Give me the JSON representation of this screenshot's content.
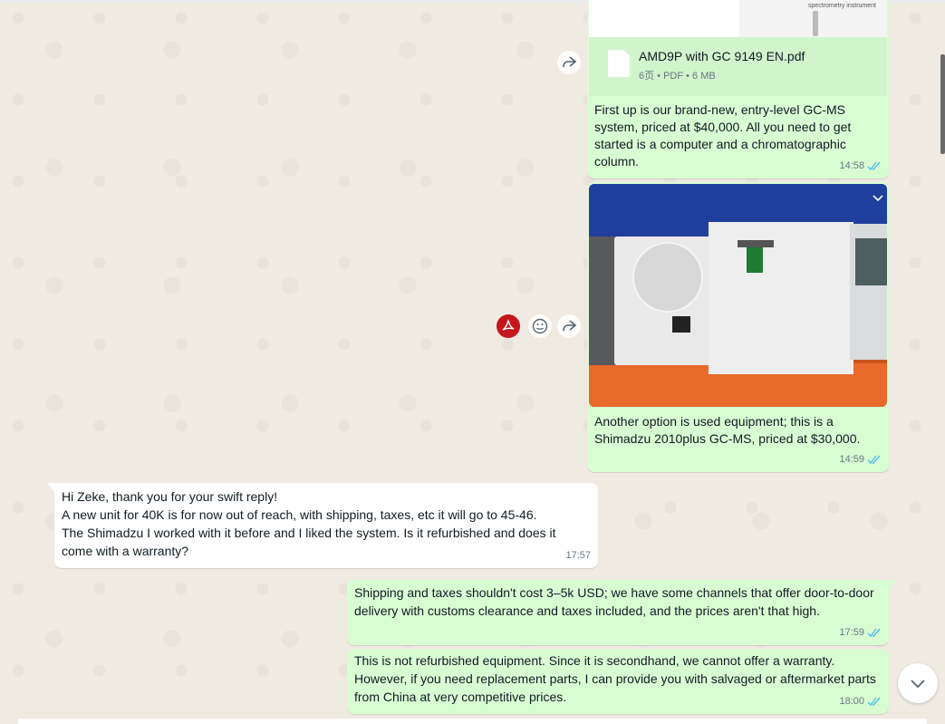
{
  "document": {
    "file_name": "AMD9P with GC 9149 EN.pdf",
    "file_meta": "6页 • PDF • 6 MB",
    "thumb_caption": "spectrometry instrument",
    "text": "First up is our brand-new, entry-level GC-MS system, priced at $40,000. All you need to get started is a computer and a chromatographic column.",
    "time": "14:58"
  },
  "image_message": {
    "text": "Another option is used equipment; this is a Shimadzu 2010plus GC-MS, priced at $30,000.",
    "time": "14:59"
  },
  "incoming": {
    "text": "Hi Zeke, thank you for your swift reply!\nA new unit for 40K is for now out of reach, with shipping, taxes, etc it will go to 45-46.\nThe Shimadzu I worked with it before and I liked the system. Is it refurbished and does it come with a warranty?",
    "time": "17:57"
  },
  "reply_1": {
    "text": "Shipping and taxes shouldn't cost 3–5k USD; we have some channels that offer door-to-door delivery with customs clearance and taxes included, and the prices aren't that high.",
    "time": "17:59"
  },
  "reply_2": {
    "text": "This is not refurbished equipment. Since it is secondhand, we cannot offer a warranty. However, if you need replacement parts, I can provide you with salvaged or aftermarket parts from China at very competitive prices.",
    "time": "18:00"
  },
  "icons": {
    "forward": "forward-icon",
    "pdf": "pdf-icon",
    "emoji": "emoji-icon",
    "read": "double-check-icon",
    "scroll": "chevron-down-icon",
    "menu": "chevron-down-icon",
    "file": "file-icon"
  },
  "colors": {
    "outgoing": "#d9fdd3",
    "incoming": "#ffffff",
    "read_ticks": "#53bdeb",
    "background": "#efeae2"
  }
}
